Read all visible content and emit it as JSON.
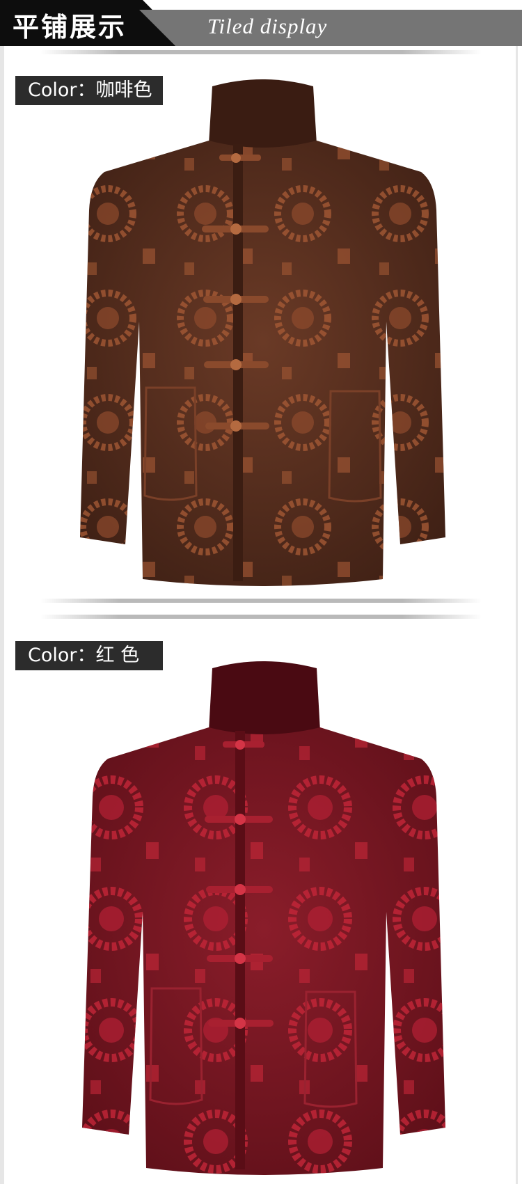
{
  "header": {
    "title_cn": "平铺展示",
    "title_en": "Tiled display"
  },
  "sections": [
    {
      "label": "Color：咖啡色",
      "jacket_color": "#5a2e1e",
      "pattern_color": "#a85a35"
    },
    {
      "label": "Color：红  色",
      "jacket_color": "#7a1722",
      "pattern_color": "#c42638"
    }
  ]
}
